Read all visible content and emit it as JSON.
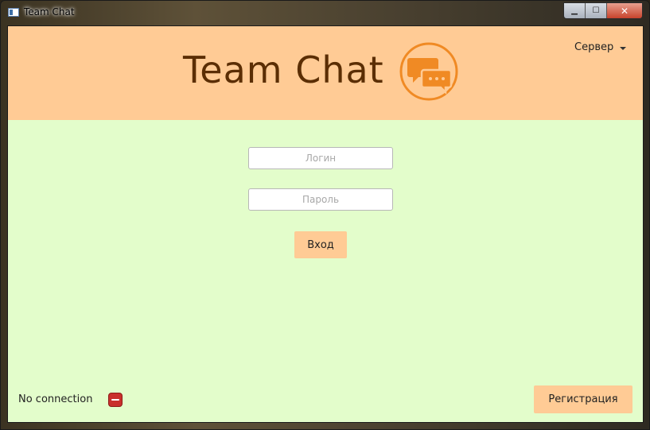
{
  "window": {
    "title": "Team Chat",
    "controls": {
      "minimize": "▁",
      "maximize": "☐",
      "close": "✕"
    }
  },
  "header": {
    "logo_text": "Team Chat",
    "logo_icon": "chat-bubbles-icon",
    "server_menu_label": "Сервер"
  },
  "form": {
    "login_placeholder": "Логин",
    "login_value": "",
    "password_placeholder": "Пароль",
    "password_value": "",
    "login_button": "Вход"
  },
  "footer": {
    "status_text": "No connection",
    "status_icon": "disconnected-icon",
    "register_button": "Регистрация"
  },
  "colors": {
    "header_bg": "#ffcb95",
    "body_bg": "#e3fdcb",
    "logo_text": "#5b2e04",
    "logo_icon": "#f08a24",
    "status_red": "#c9302c"
  }
}
